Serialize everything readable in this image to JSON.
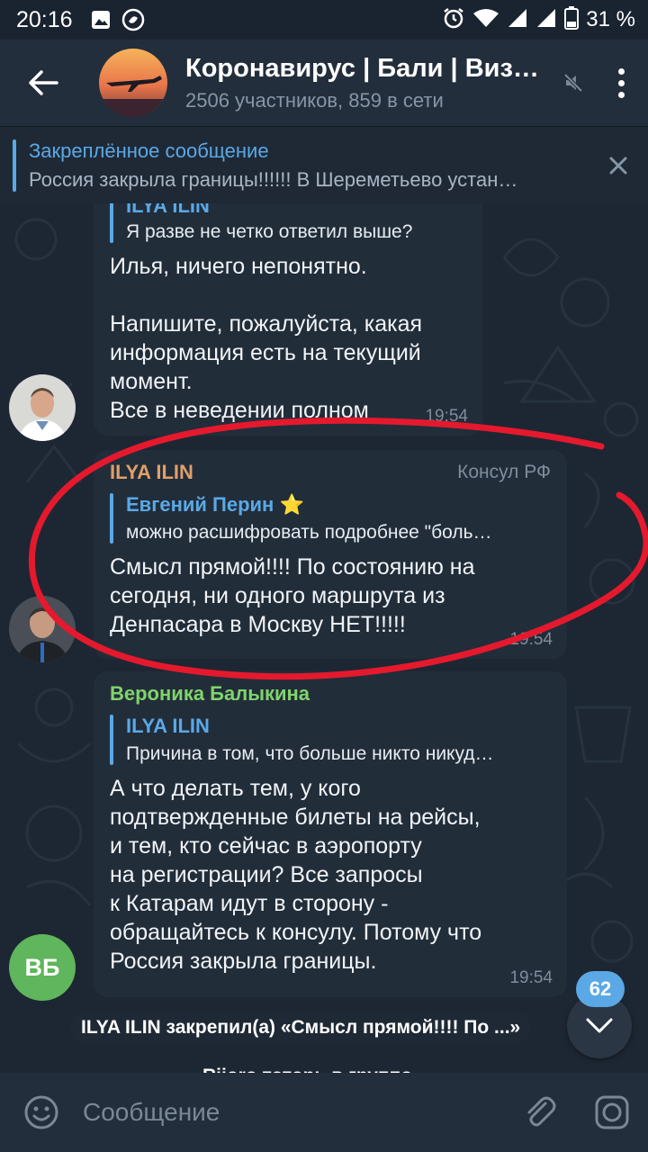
{
  "status_bar": {
    "time": "20:16",
    "battery": "31 %"
  },
  "header": {
    "title": "Коронавирус | Бали | Виз…",
    "subtitle": "2506 участников, 859 в сети"
  },
  "pinned": {
    "title": "Закреплённое сообщение",
    "text": "Россия закрыла границы!!!!!! В Шереметьево устан…"
  },
  "messages": [
    {
      "reply_name": "ILYA ILIN",
      "reply_text": "Я разве не четко ответил выше?",
      "text": "Илья, ничего непонятно.\n\nНапишите, пожалуйста, какая\nинформация есть на текущий\nмомент.\nВсе в неведении полном",
      "time": "19:54"
    },
    {
      "sender": "ILYA ILIN",
      "badge": "Консул РФ",
      "reply_name": "Евгений Перин ⭐",
      "reply_text": "можно расшифровать подробнее \"боль…",
      "text": "Смысл прямой!!!! По состоянию на\nсегодня, ни одного маршрута из\nДенпасара в Москву НЕТ!!!!!",
      "time": "19:54"
    },
    {
      "sender": "Вероника Балыкина",
      "reply_name": "ILYA ILIN",
      "reply_text": "Причина в том, что больше никто никуд…",
      "text": "А что делать тем, у кого\nподтвержденные билеты на рейсы,\nи тем, кто сейчас в аэропорту\nна регистрации? Все запросы\nк Катарам идут в сторону -\nобращайтесь к консулу. Потому что\nРоссия закрыла границы.",
      "time": "19:54",
      "avatar_initials": "ВБ"
    }
  ],
  "service_message": "ILYA ILIN закрепил(а) «Смысл прямой!!!! По ...»",
  "service_message_2": "Rijoro тоторь в группо",
  "unread_count": "62",
  "input": {
    "placeholder": "Сообщение"
  },
  "colors": {
    "accent": "#5aa9e6",
    "consul_name": "#e0a06a",
    "veronika_name": "#7fd46a",
    "annotation": "#e5192d"
  }
}
